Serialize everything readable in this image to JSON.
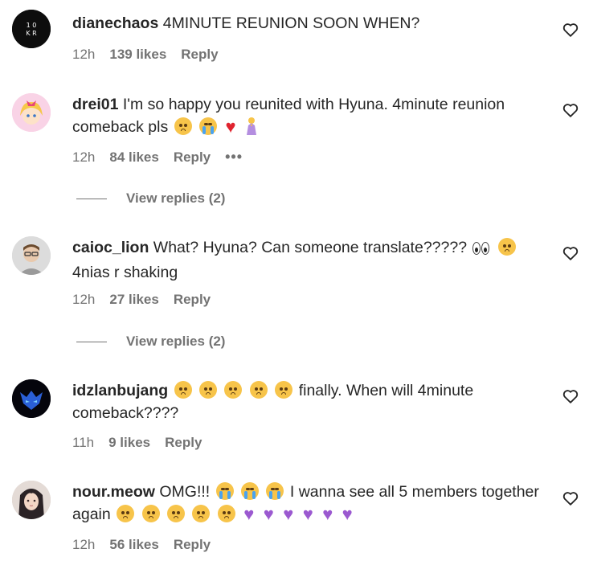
{
  "comments": [
    {
      "username": "dianechaos",
      "text": "4MINUTE REUNION SOON WHEN?",
      "time": "12h",
      "likes": "139 likes",
      "reply": "Reply"
    },
    {
      "username": "drei01",
      "text": "I'm so happy you reunited with Hyuna. 4minute reunion comeback pls",
      "time": "12h",
      "likes": "84 likes",
      "reply": "Reply",
      "more": "•••",
      "view_replies": "View replies (2)"
    },
    {
      "username": "caioc_lion",
      "text": "What? Hyuna? Can someone translate?????",
      "text2": "4nias r shaking",
      "time": "12h",
      "likes": "27 likes",
      "reply": "Reply",
      "view_replies": "View replies (2)"
    },
    {
      "username": "idzlanbujang",
      "text": "finally. When will 4minute comeback????",
      "time": "11h",
      "likes": "9 likes",
      "reply": "Reply"
    },
    {
      "username": "nour.meow",
      "text": "OMG!!!",
      "text2": "I wanna see all 5 members together again",
      "time": "12h",
      "likes": "56 likes",
      "reply": "Reply"
    }
  ],
  "icons": {
    "like": "heart-outline-icon"
  }
}
